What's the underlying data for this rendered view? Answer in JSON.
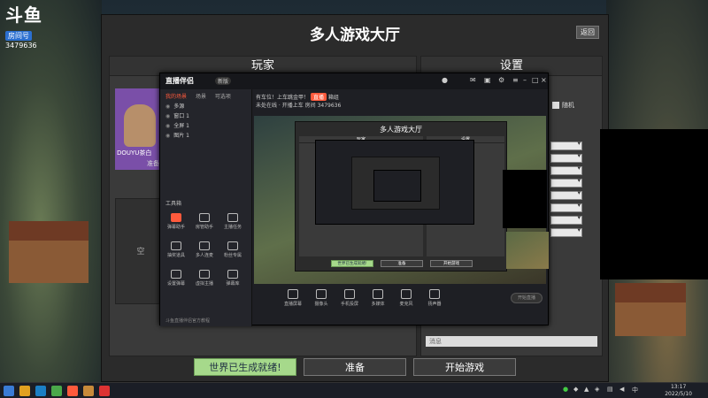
{
  "logo": {
    "brand": "斗鱼",
    "sub": "房间号",
    "room": "3479636"
  },
  "lobby": {
    "title": "多人游戏大厅",
    "back": "返回",
    "players_head": "玩家",
    "settings_head": "设置",
    "player_name": "DOUYU茶白",
    "ready_tag": "准备",
    "empty_slot": "空",
    "random_label": "随机",
    "message_placeholder": "消息",
    "btn_world": "世界已生成就绪!",
    "btn_ready": "准备",
    "btn_start": "开始游戏"
  },
  "companion": {
    "logo": "直播伴侣",
    "version": "新版",
    "tabs": [
      "我的场景",
      "场景",
      "可选项"
    ],
    "scenes": [
      "多源",
      "窗口 1",
      "全屏 1",
      "图片 1"
    ],
    "tools_head": "工具箱",
    "tools": [
      "弹幕助手",
      "房管助手",
      "主播任务",
      "抽奖道具",
      "多人连麦",
      "粉丝专属",
      "设置弹幕",
      "虚拟主播",
      "弹幕库"
    ],
    "live_title": "有车位！上车跳金甲！",
    "live_badge": "直播",
    "live_tag": "箱组",
    "info_line": "未处在线 · 开播上车",
    "room_label": "房间",
    "room": "3479636",
    "bar_tools": [
      "直播屏幕",
      "摄像头",
      "手机投屏",
      "多媒体",
      "麦克风",
      "扬声器"
    ],
    "start_live": "开始直播",
    "bottom_note": "斗鱼直播伴侣官方教程"
  },
  "nested": {
    "title": "多人游戏大厅",
    "players": "玩家",
    "settings": "设置",
    "btn_world": "世界已生成就绪!",
    "btn_ready": "准备",
    "btn_start": "开始游戏"
  },
  "taskbar": {
    "time": "13:17",
    "date": "2022/5/10"
  },
  "colors": {
    "accent": "#ff5a3c",
    "ready_green": "#a6d98b",
    "panel": "#2b2b2b"
  }
}
